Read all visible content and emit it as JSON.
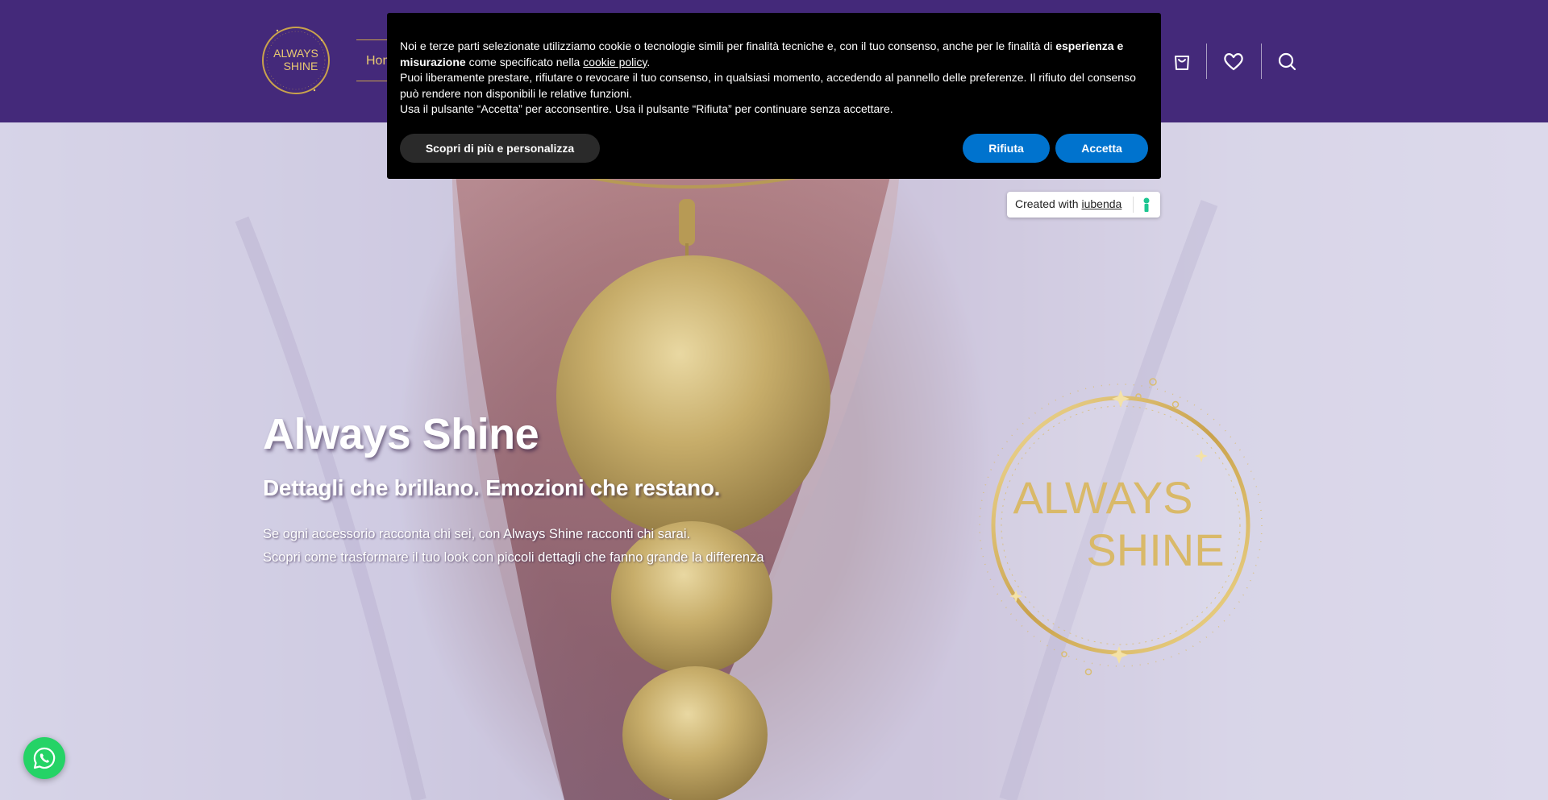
{
  "colors": {
    "header_bg": "#44297a",
    "gold": "#c9a24c",
    "cookie_bg": "#000000",
    "cookie_button": "#0073ce",
    "whatsapp": "#25d366"
  },
  "header": {
    "logo_text_line1": "ALWAYS",
    "logo_text_line2": "SHINE",
    "nav_home": "Home",
    "cart_label": "€",
    "icons": [
      "cart-icon",
      "heart-icon",
      "search-icon"
    ]
  },
  "cookie_banner": {
    "text_part1": "Noi e terze parti selezionate utilizziamo cookie o tecnologie simili per finalità tecniche e, con il tuo consenso, anche per le finalità di ",
    "text_bold": "esperienza e misurazione",
    "text_part2": " come specificato nella ",
    "policy_link": "cookie policy",
    "text_part3": ".",
    "paragraph2": "Puoi liberamente prestare, rifiutare o revocare il tuo consenso, in qualsiasi momento, accedendo al pannello delle preferenze. Il rifiuto del consenso può rendere non disponibili le relative funzioni.",
    "paragraph3": "Usa il pulsante “Accetta” per acconsentire. Usa il pulsante “Rifiuta” per continuare senza accettare.",
    "btn_more": "Scopri di più e personalizza",
    "btn_reject": "Rifiuta",
    "btn_accept": "Accetta"
  },
  "iubenda_badge": {
    "prefix": "Created with ",
    "link": "iubenda"
  },
  "hero": {
    "title": "Always Shine",
    "subtitle": "Dettagli che brillano. Emozioni che restano.",
    "line1": "Se ogni accessorio racconta chi sei, con Always Shine racconti chi sarai.",
    "line2": "Scopri come trasformare il tuo look con piccoli dettagli che fanno grande la differenza",
    "logo_line1": "ALWAYS",
    "logo_line2": "SHINE"
  },
  "whatsapp": {
    "icon": "whatsapp-icon"
  }
}
